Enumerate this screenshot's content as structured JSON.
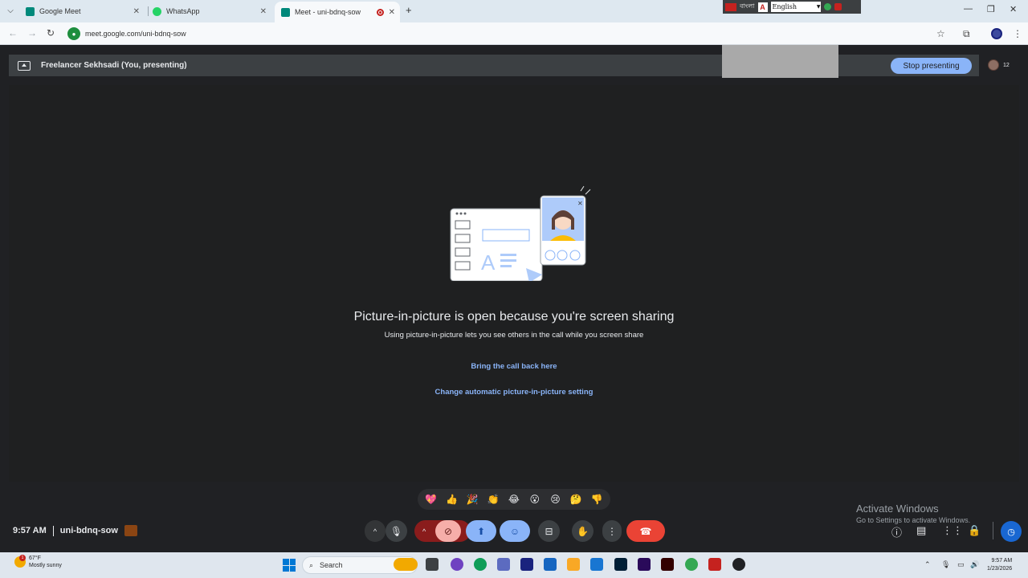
{
  "browser": {
    "tabs": [
      {
        "title": "Google Meet",
        "favicon_color": "#00897b"
      },
      {
        "title": "WhatsApp",
        "favicon_color": "#25d366"
      },
      {
        "title": "Meet - uni-bdnq-sow",
        "favicon_color": "#00897b",
        "active": true
      }
    ],
    "url": "meet.google.com/uni-bdnq-sow",
    "new_tab_label": "+",
    "lang_toolbar": {
      "script_label": "বাংলা",
      "language": "English"
    }
  },
  "meet": {
    "presenter_label": "Freelancer Sekhsadi (You, presenting)",
    "stop_presenting_label": "Stop presenting",
    "participant_count": "12",
    "pip_title": "Picture-in-picture is open because you're screen sharing",
    "pip_subtitle": "Using picture-in-picture lets you see others in the call while you screen share",
    "bring_back_link": "Bring the call back here",
    "change_setting_link": "Change automatic picture-in-picture setting",
    "reactions": [
      "💖",
      "👍",
      "🎉",
      "👏",
      "😂",
      "😮",
      "😢",
      "🤔",
      "👎"
    ],
    "time": "9:57 AM",
    "meeting_code": "uni-bdnq-sow"
  },
  "windows": {
    "activate_title": "Activate Windows",
    "activate_sub": "Go to Settings to activate Windows.",
    "weather_temp": "67°F",
    "weather_desc": "Mostly sunny",
    "weather_badge": "1",
    "search_placeholder": "Search",
    "clock_time": "9:57 AM",
    "clock_date": "1/23/2026"
  },
  "colors": {
    "accent": "#8ab4f8",
    "end_call": "#ea4335",
    "stage_bg": "#1f2021",
    "bar_bg": "#3c4043"
  }
}
